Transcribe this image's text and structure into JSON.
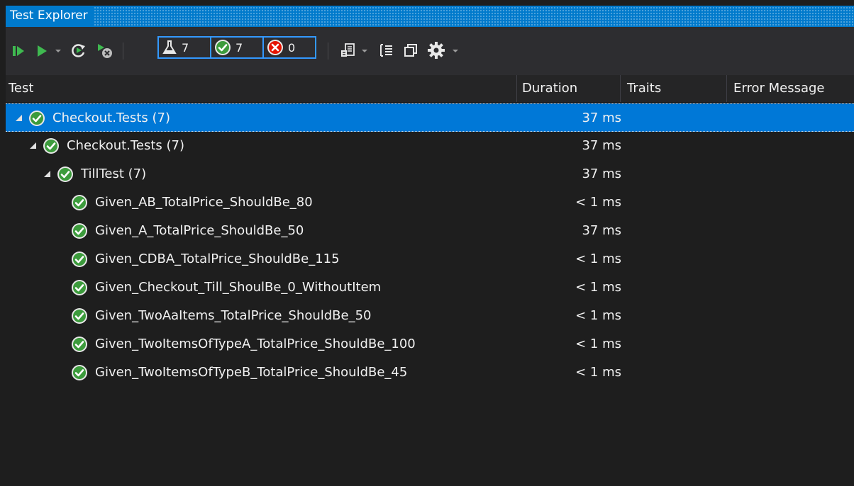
{
  "window": {
    "title": "Test Explorer"
  },
  "toolbar": {
    "run_all_icon": "run-all-icon",
    "run_icon": "run-icon",
    "repeat_icon": "repeat-last-run-icon",
    "cancel_icon": "cancel-run-icon",
    "total_count": "7",
    "passed_count": "7",
    "failed_count": "0",
    "playlist_icon": "playlist-icon",
    "group_icon": "group-by-icon",
    "copy_icon": "copy-icon",
    "settings_icon": "gear-icon"
  },
  "columns": {
    "test": "Test",
    "duration": "Duration",
    "traits": "Traits",
    "error": "Error Message"
  },
  "tests": [
    {
      "name": "Checkout.Tests (7)",
      "duration": "37 ms",
      "level": 0,
      "expandable": true,
      "selected": true
    },
    {
      "name": "Checkout.Tests (7)",
      "duration": "37 ms",
      "level": 1,
      "expandable": true,
      "selected": false
    },
    {
      "name": "TillTest (7)",
      "duration": "37 ms",
      "level": 2,
      "expandable": true,
      "selected": false
    },
    {
      "name": "Given_AB_TotalPrice_ShouldBe_80",
      "duration": "< 1 ms",
      "level": 3,
      "expandable": false,
      "selected": false
    },
    {
      "name": "Given_A_TotalPrice_ShouldBe_50",
      "duration": "37 ms",
      "level": 3,
      "expandable": false,
      "selected": false
    },
    {
      "name": "Given_CDBA_TotalPrice_ShouldBe_115",
      "duration": "< 1 ms",
      "level": 3,
      "expandable": false,
      "selected": false
    },
    {
      "name": "Given_Checkout_Till_ShoulBe_0_WithoutItem",
      "duration": "< 1 ms",
      "level": 3,
      "expandable": false,
      "selected": false
    },
    {
      "name": "Given_TwoAaItems_TotalPrice_ShouldBe_50",
      "duration": "< 1 ms",
      "level": 3,
      "expandable": false,
      "selected": false
    },
    {
      "name": "Given_TwoItemsOfTypeA_TotalPrice_ShouldBe_100",
      "duration": "< 1 ms",
      "level": 3,
      "expandable": false,
      "selected": false
    },
    {
      "name": "Given_TwoItemsOfTypeB_TotalPrice_ShouldBe_45",
      "duration": "< 1 ms",
      "level": 3,
      "expandable": false,
      "selected": false
    }
  ],
  "colors": {
    "accent": "#007acc",
    "selection": "#0078d7",
    "pass": "#3c9b3c",
    "fail": "#e51400",
    "run": "#3fb950"
  }
}
